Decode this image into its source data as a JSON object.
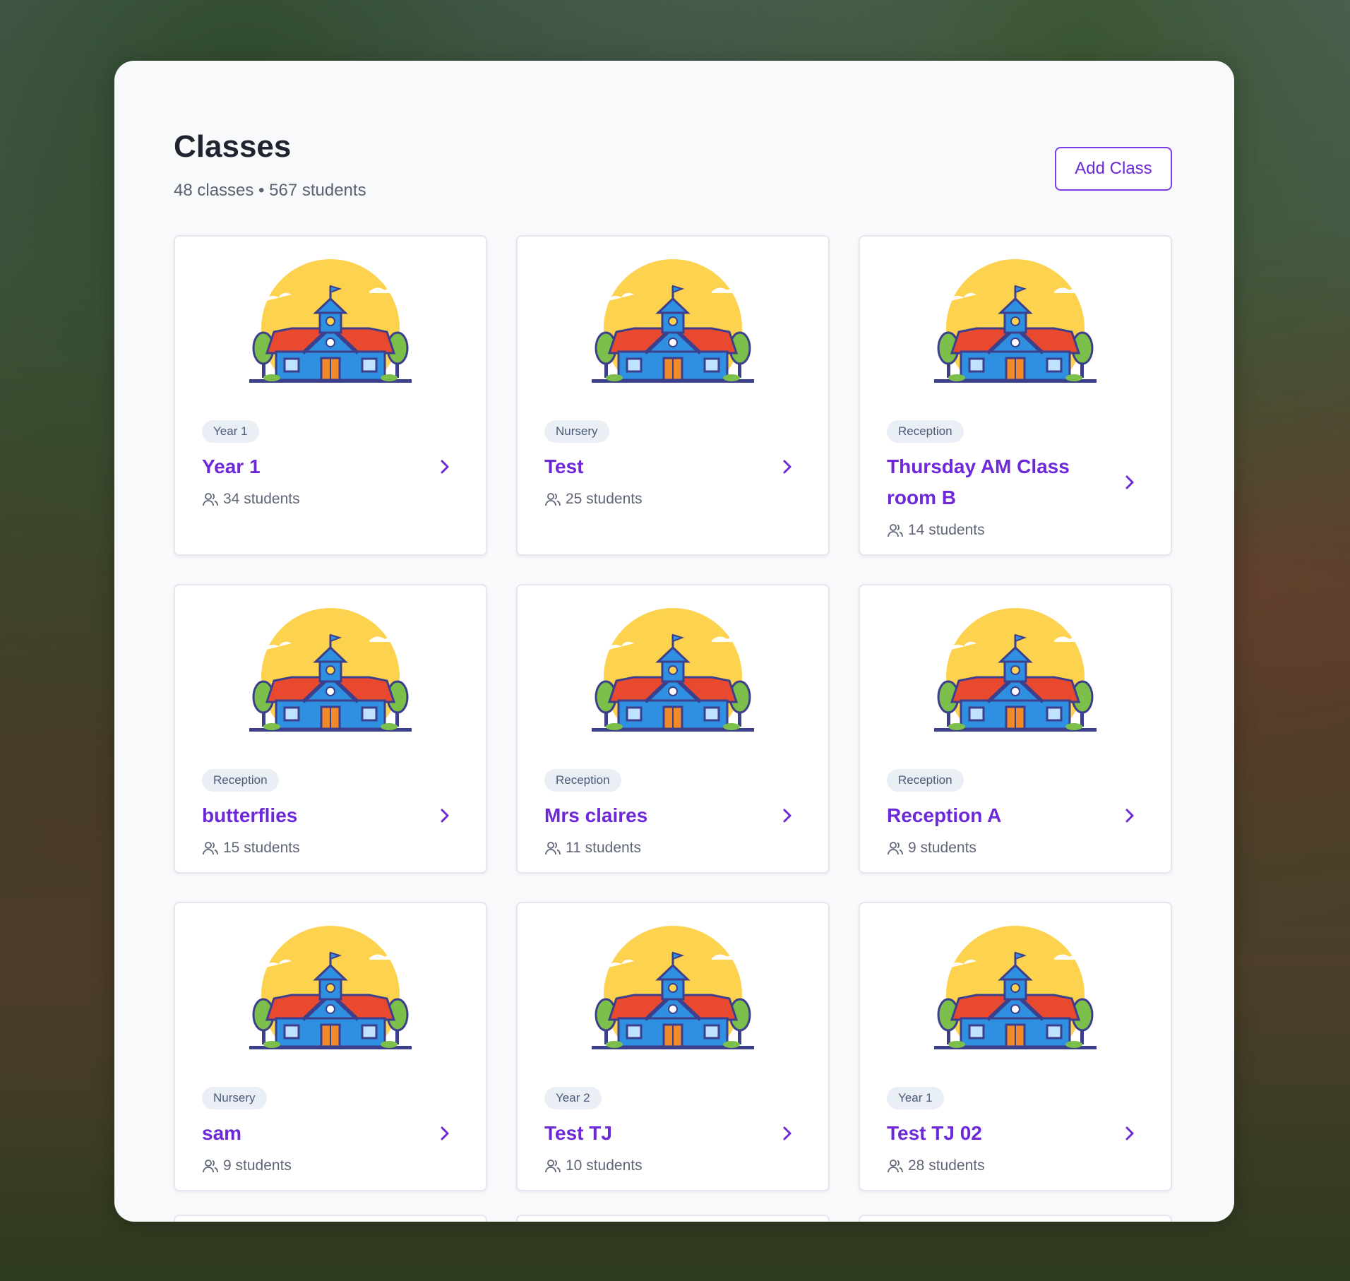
{
  "page": {
    "title": "Classes",
    "subtitle": "48 classes • 567 students",
    "add_button": "Add Class"
  },
  "colors": {
    "accent": "#6d28d9",
    "badge_bg": "#eaeef5",
    "panel_bg": "#f8f9fb"
  },
  "classes": [
    {
      "badge": "Year 1",
      "name": "Year 1",
      "students": "34 students"
    },
    {
      "badge": "Nursery",
      "name": "Test",
      "students": "25 students"
    },
    {
      "badge": "Reception",
      "name": "Thursday AM Class room B",
      "students": "14 students"
    },
    {
      "badge": "Reception",
      "name": "butterflies",
      "students": "15 students"
    },
    {
      "badge": "Reception",
      "name": "Mrs claires",
      "students": "11 students"
    },
    {
      "badge": "Reception",
      "name": "Reception A",
      "students": "9 students"
    },
    {
      "badge": "Nursery",
      "name": "sam",
      "students": "9 students"
    },
    {
      "badge": "Year 2",
      "name": "Test TJ",
      "students": "10 students"
    },
    {
      "badge": "Year 1",
      "name": "Test TJ 02",
      "students": "28 students"
    }
  ]
}
